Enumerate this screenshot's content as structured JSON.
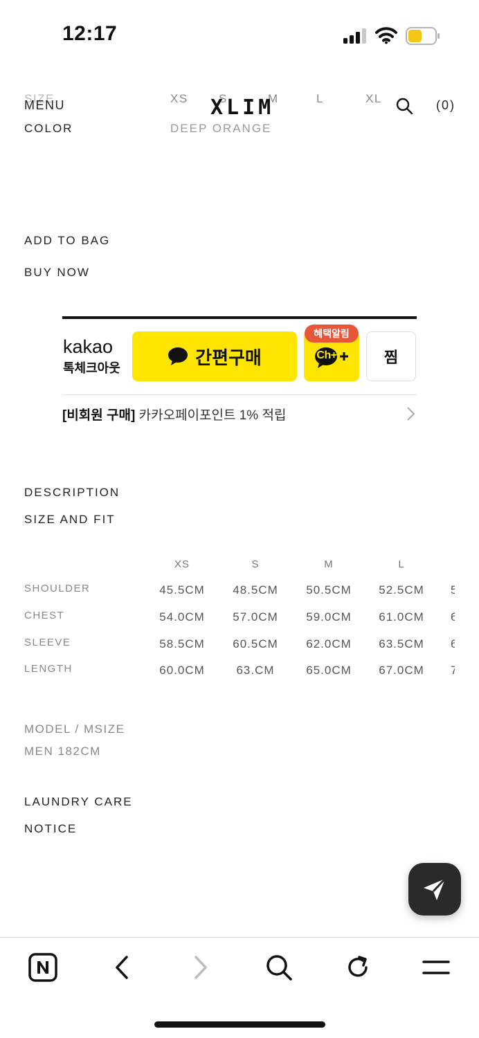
{
  "status": {
    "time": "12:17"
  },
  "header": {
    "menu": "MENU",
    "logo": "XLIM",
    "cart": "(0)"
  },
  "options": {
    "size_label": "SIZE",
    "sizes": [
      "XS",
      "S",
      "M",
      "L",
      "XL"
    ],
    "color_label": "COLOR",
    "color_value": "DEEP ORANGE"
  },
  "actions": {
    "add_to_bag": "ADD TO BAG",
    "buy_now": "BUY NOW"
  },
  "kakao": {
    "logo": "kakao",
    "subtitle": "톡체크아웃",
    "buy_label": "간편구매",
    "badge": "혜택알림",
    "channel_label": "Ch+",
    "zzim": "찜",
    "promo_bold": "[비회원 구매]",
    "promo_text": " 카카오페이포인트 1% 적립",
    "colors": {
      "yellow": "#fee500",
      "badge": "#e8563a"
    }
  },
  "sections": {
    "description": "DESCRIPTION",
    "size_and_fit": "SIZE AND FIT"
  },
  "size_table": {
    "headers": [
      "XS",
      "S",
      "M",
      "L"
    ],
    "rows": [
      {
        "label": "SHOULDER",
        "values": [
          "45.5CM",
          "48.5CM",
          "50.5CM",
          "52.5CM",
          "5"
        ]
      },
      {
        "label": "CHEST",
        "values": [
          "54.0CM",
          "57.0CM",
          "59.0CM",
          "61.0CM",
          "6"
        ]
      },
      {
        "label": "SLEEVE",
        "values": [
          "58.5CM",
          "60.5CM",
          "62.0CM",
          "63.5CM",
          "6"
        ]
      },
      {
        "label": "LENGTH",
        "values": [
          "60.0CM",
          "63.CM",
          "65.0CM",
          "67.0CM",
          "7"
        ]
      }
    ]
  },
  "model": {
    "label": "MODEL / MSIZE",
    "value": "MEN 182CM"
  },
  "footer_links": {
    "laundry": "LAUNDRY CARE",
    "notice": "NOTICE"
  },
  "browser_bar": {
    "icons": [
      "naver-home-icon",
      "back-icon",
      "forward-icon",
      "search-icon",
      "refresh-icon",
      "menu-icon"
    ]
  }
}
